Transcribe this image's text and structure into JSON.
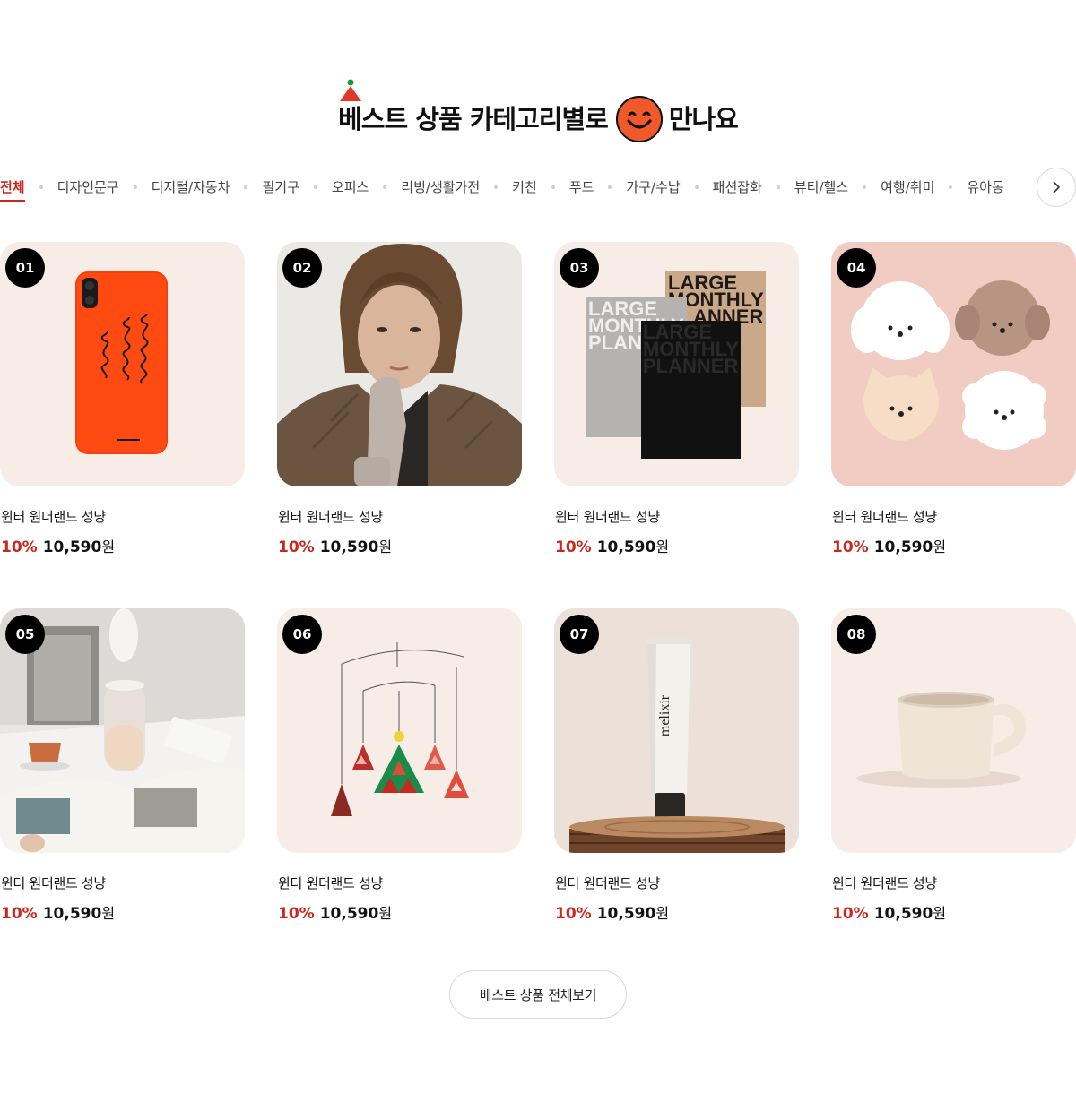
{
  "section": {
    "title_part1": "베스트 상품 카테고리별로",
    "title_part2": "만나요"
  },
  "tabs": [
    {
      "label": "전체",
      "active": true
    },
    {
      "label": "디자인문구"
    },
    {
      "label": "디지털/자동차"
    },
    {
      "label": "필기구"
    },
    {
      "label": "오피스"
    },
    {
      "label": "리빙/생활가전"
    },
    {
      "label": "키친"
    },
    {
      "label": "푸드"
    },
    {
      "label": "가구/수납"
    },
    {
      "label": "패션잡화"
    },
    {
      "label": "뷰티/헬스"
    },
    {
      "label": "여행/취미"
    },
    {
      "label": "유아동"
    }
  ],
  "colors": {
    "accent": "#c8281f",
    "card_bg": "#f7ece6"
  },
  "products": [
    {
      "rank": "01",
      "name": "윈터 원더랜드 성냥",
      "discount": "10%",
      "price": "10,590",
      "currency": "원",
      "image": "orange-phone-case"
    },
    {
      "rank": "02",
      "name": "윈터 원더랜드 성냥",
      "discount": "10%",
      "price": "10,590",
      "currency": "원",
      "image": "model-knit-gloves"
    },
    {
      "rank": "03",
      "name": "윈터 원더랜드 성냥",
      "discount": "10%",
      "price": "10,590",
      "currency": "원",
      "image": "monthly-planners",
      "image_text": [
        "LARGE",
        "MONTHLY",
        "PLANNER"
      ]
    },
    {
      "rank": "04",
      "name": "윈터 원더랜드 성냥",
      "discount": "10%",
      "price": "10,590",
      "currency": "원",
      "image": "puppy-memo-pads"
    },
    {
      "rank": "05",
      "name": "윈터 원더랜드 성냥",
      "discount": "10%",
      "price": "10,590",
      "currency": "원",
      "image": "humidifier-tea"
    },
    {
      "rank": "06",
      "name": "윈터 원더랜드 성냥",
      "discount": "10%",
      "price": "10,590",
      "currency": "원",
      "image": "christmas-tree-mobile"
    },
    {
      "rank": "07",
      "name": "윈터 원더랜드 성냥",
      "discount": "10%",
      "price": "10,590",
      "currency": "원",
      "image": "melixir-tube",
      "image_text": [
        "melixir"
      ]
    },
    {
      "rank": "08",
      "name": "윈터 원더랜드 성냥",
      "discount": "10%",
      "price": "10,590",
      "currency": "원",
      "image": "ceramic-mug"
    }
  ],
  "more_button": {
    "label": "베스트 상품 전체보기"
  }
}
